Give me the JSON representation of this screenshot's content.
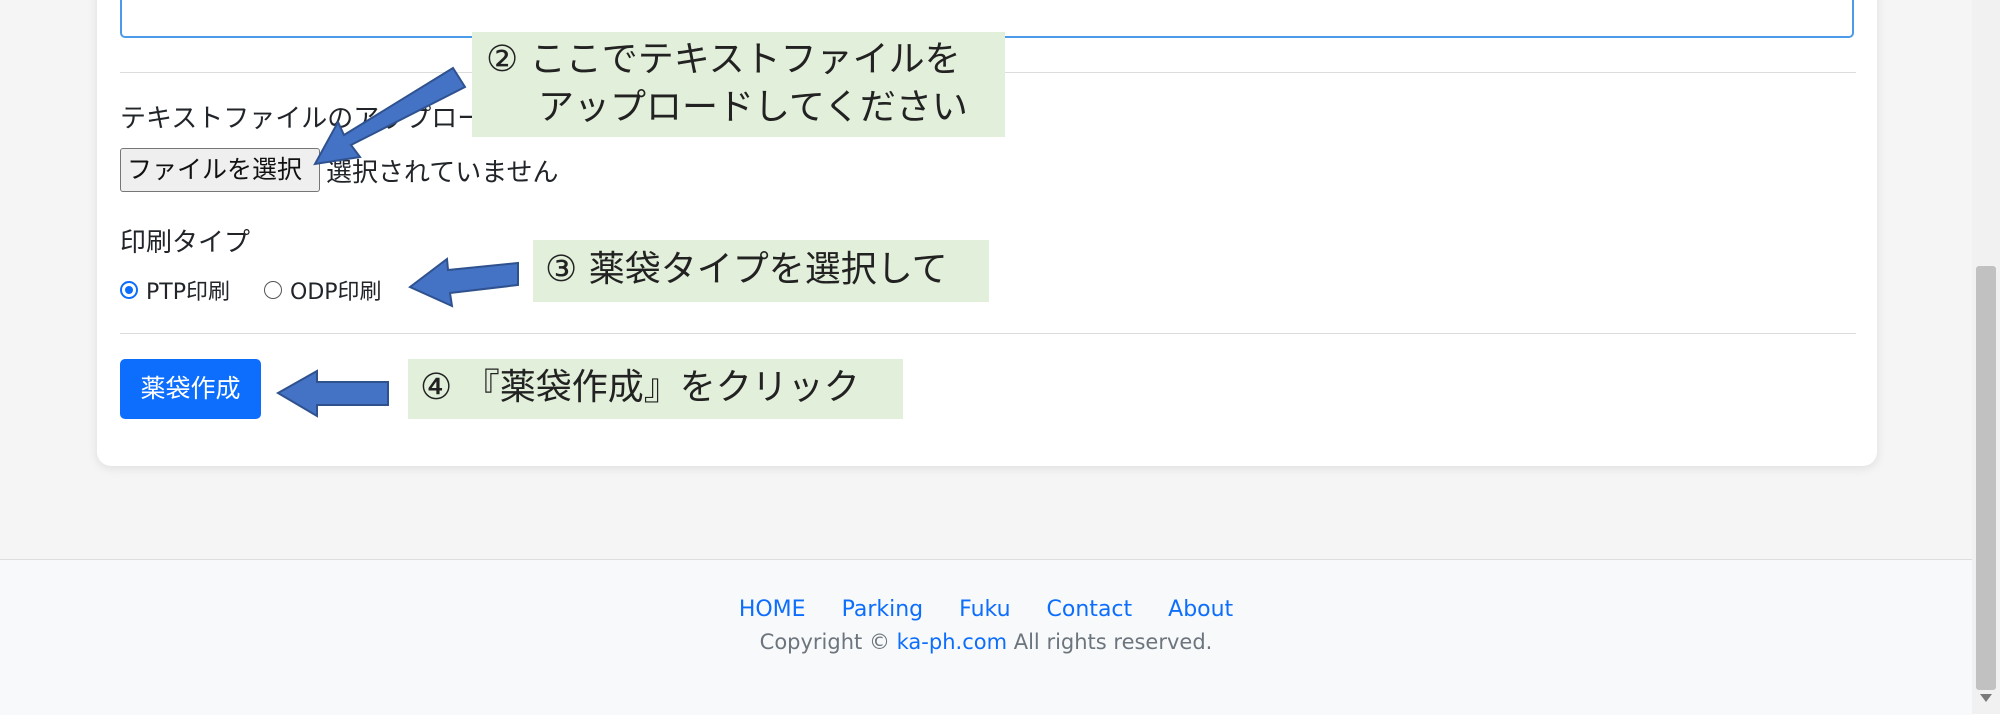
{
  "form": {
    "upload_label": "テキストファイルのアップロード",
    "file_button_label": "ファイルを選択",
    "file_status": "選択されていません",
    "print_type_label": "印刷タイプ",
    "print_types": [
      {
        "label": "PTP印刷",
        "checked": true
      },
      {
        "label": "ODP印刷",
        "checked": false
      }
    ],
    "submit_label": "薬袋作成"
  },
  "annotations": {
    "step2_line1": "② ここでテキストファイルを",
    "step2_line2": "アップロードしてください",
    "step3": "③ 薬袋タイプを選択して",
    "step4": "④ 『薬袋作成』をクリック",
    "callout_bg": "#e2efda",
    "arrow_color": "#4472c4"
  },
  "footer": {
    "nav": [
      "HOME",
      "Parking",
      "Fuku",
      "Contact",
      "About"
    ],
    "copyright_prefix": "Copyright ©",
    "copyright_site": "ka-ph.com",
    "copyright_suffix": "All rights reserved."
  },
  "colors": {
    "primary": "#0d6efd",
    "focus_border": "#4b9be8",
    "footer_bg": "#f8f9fa"
  }
}
